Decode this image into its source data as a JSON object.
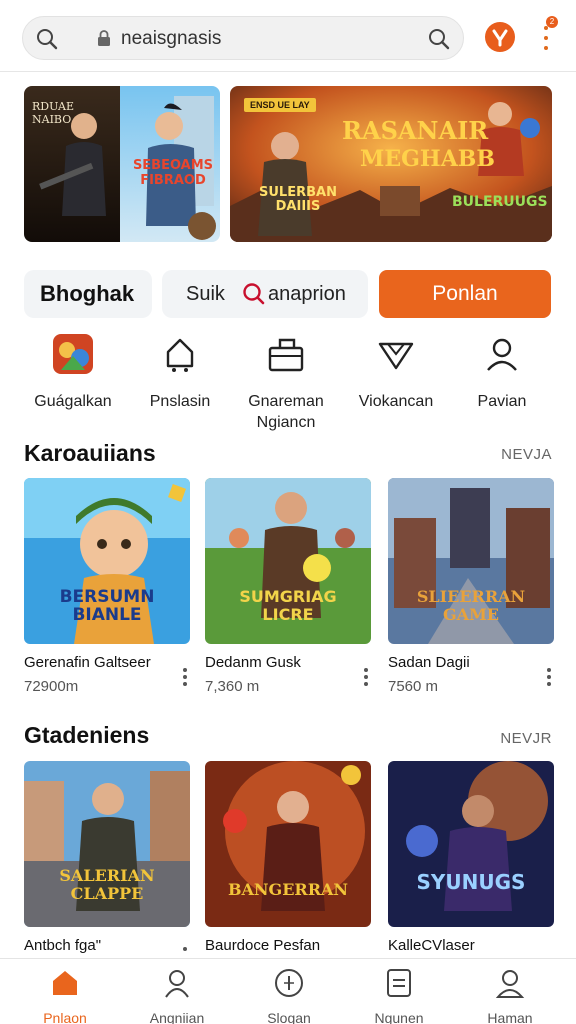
{
  "search": {
    "url": "neaisgnasis"
  },
  "notification_count": "2",
  "tiles": [
    {
      "label": "Bhoghak"
    },
    {
      "label_left": "Suik",
      "label_right": "anaprion"
    }
  ],
  "cta_label": "Ponlan",
  "categories": [
    {
      "label": "Guágalkan",
      "icon": "game-art-icon"
    },
    {
      "label": "Pnslasin",
      "icon": "home-icon"
    },
    {
      "label": "Gnareman\nNgiancn",
      "icon": "briefcase-icon"
    },
    {
      "label": "Viokancan",
      "icon": "shield-icon"
    },
    {
      "label": "Pavian",
      "icon": "user-icon"
    }
  ],
  "section1": {
    "title": "Karoauiians",
    "more": "NEVJA",
    "items": [
      {
        "name": "Gerenafin Galtseer",
        "sub": "72900m",
        "art": "BERSUMN BIANLE"
      },
      {
        "name": "Dedanm Gusk",
        "sub": "7,360 m",
        "art": "SUMGRIAG LICRE"
      },
      {
        "name": "Sadan Dagii",
        "sub": "7560 m",
        "art": "SLIEERRAN GAME"
      }
    ]
  },
  "section2": {
    "title": "Gtadeniens",
    "more": "NEVJR",
    "items": [
      {
        "name": "Antbch fga\"",
        "art": "SALERIAN CLAPPE"
      },
      {
        "name": "Baurdoce Pesfan",
        "art": "BANGERRAN"
      },
      {
        "name": "KalleCVlaser",
        "art": "SYUNUGS"
      }
    ]
  },
  "banners": [
    {
      "left_text": "RDUAE NAIBO",
      "right_text": "SEBEOAMS FIBRAOD"
    },
    {
      "top_tag": "ENSD UE LAY",
      "headline_1": "RASANAIR",
      "headline_2": "MEGHABB",
      "left_logo": "SULERBAN DAIIIS",
      "right_logo": "BULERUUGS"
    }
  ],
  "bottom_nav": [
    {
      "label": "Pnlaon",
      "icon": "home-icon",
      "active": true
    },
    {
      "label": "Angniian",
      "icon": "user-icon",
      "active": false
    },
    {
      "label": "Slogan",
      "icon": "compass-icon",
      "active": false
    },
    {
      "label": "Ngunen",
      "icon": "document-icon",
      "active": false
    },
    {
      "label": "Haman",
      "icon": "profile-icon",
      "active": false
    }
  ],
  "colors": {
    "accent": "#e9651d",
    "text": "#111111",
    "muted": "#666666",
    "chip_bg": "#f2f4f6"
  }
}
